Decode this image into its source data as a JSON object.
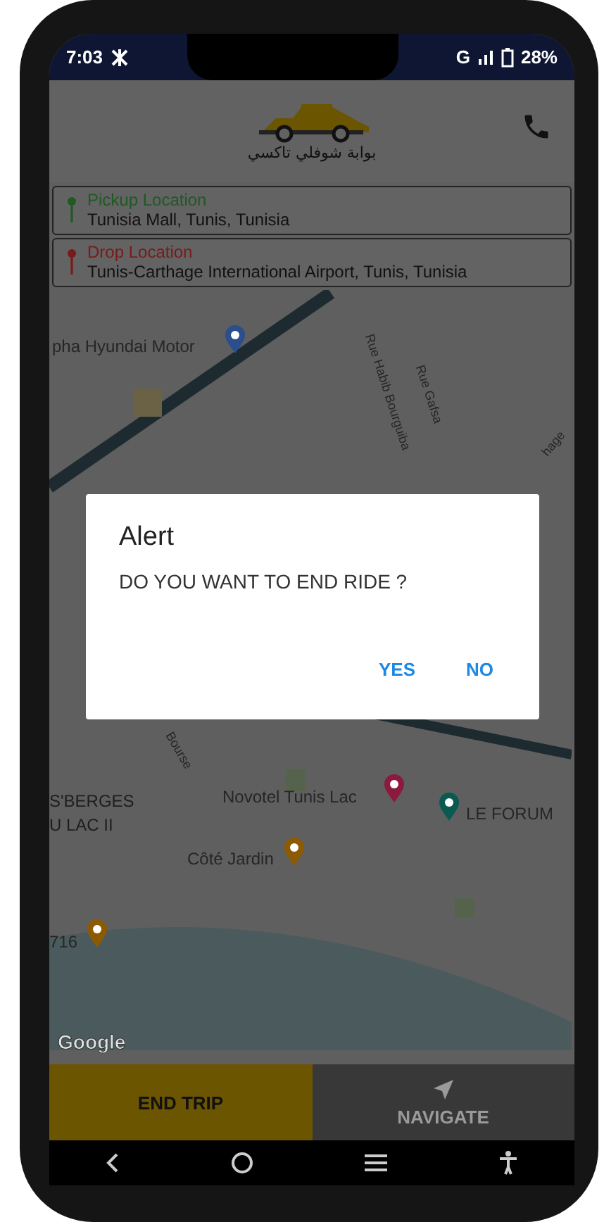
{
  "status_bar": {
    "time": "7:03",
    "network": "G",
    "battery": "28%"
  },
  "header": {
    "logo_text": "بوابة شوفلي تاكسي"
  },
  "locations": [
    {
      "label": "Pickup Location",
      "address": "Tunisia Mall, Tunis, Tunisia",
      "color": "#1f5a22"
    },
    {
      "label": "Drop Location",
      "address": "Tunis-Carthage International Airport, Tunis, Tunisia",
      "color": "#7a1a1a"
    }
  ],
  "map": {
    "labels": [
      {
        "text": "pha Hyundai Motor",
        "kind": "poi",
        "color": "#2a4f8c"
      },
      {
        "text": "Rue Habib Bourguiba",
        "kind": "street"
      },
      {
        "text": "Rue Gafsa",
        "kind": "street"
      },
      {
        "text": "hage",
        "kind": "street"
      },
      {
        "text": "Bourse",
        "kind": "street"
      },
      {
        "text": "S'BERGES",
        "kind": "area"
      },
      {
        "text": "U LAC II",
        "kind": "area"
      },
      {
        "text": "Novotel Tunis Lac",
        "kind": "poi",
        "color": "#8c1a3e"
      },
      {
        "text": "LE FORUM",
        "kind": "poi",
        "color": "#0b5a52"
      },
      {
        "text": "Côté Jardin",
        "kind": "poi",
        "color": "#8c5a00"
      },
      {
        "text": "716",
        "kind": "poi",
        "color": "#8c5a00"
      }
    ],
    "attribution": "Google"
  },
  "dialog": {
    "title": "Alert",
    "message": "DO YOU WANT TO END RIDE ?",
    "buttons": [
      "YES",
      "NO"
    ]
  },
  "actions": [
    {
      "label": "END TRIP",
      "kind": "primary"
    },
    {
      "label": "NAVIGATE",
      "kind": "secondary"
    }
  ]
}
